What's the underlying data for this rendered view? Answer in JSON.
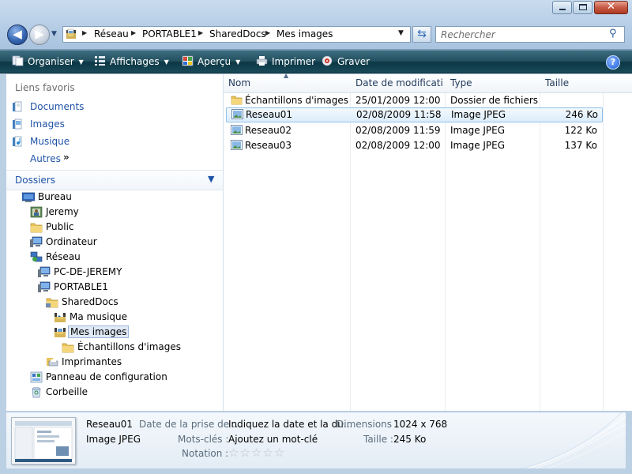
{
  "window": {
    "caption_buttons": {
      "minimize": "Minimize",
      "maximize": "Maximize",
      "close": "Close"
    }
  },
  "address": {
    "breadcrumbs": [
      "Réseau",
      "PORTABLE1",
      "SharedDocs",
      "Mes images"
    ],
    "search_placeholder": "Rechercher"
  },
  "toolbar": {
    "organize": "Organiser",
    "views": "Affichages",
    "preview": "Aperçu",
    "print": "Imprimer",
    "burn": "Graver"
  },
  "nav": {
    "favorites_title": "Liens favoris",
    "favorites": [
      "Documents",
      "Images",
      "Musique"
    ],
    "more": "Autres",
    "folders_title": "Dossiers",
    "tree": [
      {
        "label": "Bureau",
        "icon": "desktop-icon",
        "level": 0
      },
      {
        "label": "Jeremy",
        "icon": "user-folder-icon",
        "level": 1
      },
      {
        "label": "Public",
        "icon": "folder-icon",
        "level": 1
      },
      {
        "label": "Ordinateur",
        "icon": "computer-icon",
        "level": 1
      },
      {
        "label": "Réseau",
        "icon": "network-icon",
        "level": 1
      },
      {
        "label": "PC-DE-JEREMY",
        "icon": "computer-icon",
        "level": 2
      },
      {
        "label": "PORTABLE1",
        "icon": "computer-icon",
        "level": 2
      },
      {
        "label": "SharedDocs",
        "icon": "shared-folder-icon",
        "level": 3
      },
      {
        "label": "Ma musique",
        "icon": "music-folder-icon",
        "level": 4
      },
      {
        "label": "Mes images",
        "icon": "pictures-folder-icon",
        "level": 4,
        "selected": true
      },
      {
        "label": "Échantillons d'images",
        "icon": "folder-icon",
        "level": 5
      },
      {
        "label": "Imprimantes",
        "icon": "printer-icon",
        "level": 3
      },
      {
        "label": "Panneau de configuration",
        "icon": "control-panel-icon",
        "level": 1
      },
      {
        "label": "Corbeille",
        "icon": "recycle-bin-icon",
        "level": 1
      }
    ]
  },
  "files": {
    "columns": [
      "Nom",
      "Date de modificati...",
      "Type",
      "Taille"
    ],
    "rows": [
      {
        "name": "Échantillons d'images",
        "date": "25/01/2009 12:00",
        "type": "Dossier de fichiers",
        "size": "",
        "icon": "folder-icon",
        "selected": false
      },
      {
        "name": "Reseau01",
        "date": "02/08/2009 11:58",
        "type": "Image JPEG",
        "size": "246 Ko",
        "icon": "image-file-icon",
        "selected": true
      },
      {
        "name": "Reseau02",
        "date": "02/08/2009 11:59",
        "type": "Image JPEG",
        "size": "122 Ko",
        "icon": "image-file-icon",
        "selected": false
      },
      {
        "name": "Reseau03",
        "date": "02/08/2009 12:00",
        "type": "Image JPEG",
        "size": "137 Ko",
        "icon": "image-file-icon",
        "selected": false
      }
    ]
  },
  "details": {
    "name": "Reseau01",
    "type": "Image JPEG",
    "date_label": "Date de la prise de ...",
    "date_value": "Indiquez la date et la du...",
    "dimensions_label": "Dimensions :",
    "dimensions_value": "1024 x 768",
    "keywords_label": "Mots-clés :",
    "keywords_value": "Ajoutez un mot-clé",
    "size_label": "Taille :",
    "size_value": "245 Ko",
    "rating_label": "Notation :",
    "rating": 0,
    "rating_max": 5
  },
  "colors": {
    "link": "#1f53a7",
    "command_bar": "#23505f",
    "selection": "#dcecfb"
  }
}
